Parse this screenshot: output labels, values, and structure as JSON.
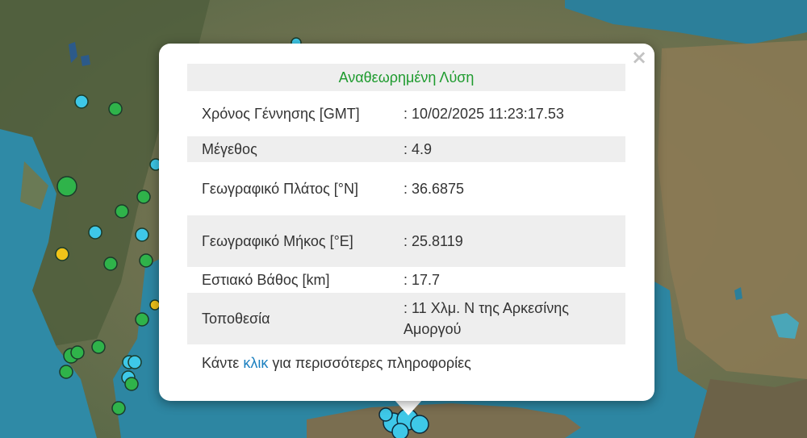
{
  "popup": {
    "title": "Αναθεωρημένη Λύση",
    "close_symbol": "×",
    "rows": [
      {
        "label": "Χρόνος Γέννησης [GMT]",
        "value": ": 10/02/2025 11:23:17.53"
      },
      {
        "label": "Μέγεθος",
        "value": ": 4.9"
      },
      {
        "label": "Γεωγραφικό Πλάτος [°N]",
        "value": ": 36.6875"
      },
      {
        "label": "Γεωγραφικό Μήκος [°E]",
        "value": ": 25.8119"
      },
      {
        "label": "Εστιακό Βάθος [km]",
        "value": ": 17.7"
      },
      {
        "label": "Τοποθεσία",
        "value": ": 11 Χλμ. Ν της Αρκεσίνης Αμοργού"
      }
    ],
    "footer_prefix": "Κάντε ",
    "footer_link": "κλικ",
    "footer_suffix": " για περισσότερες πληροφορίες"
  },
  "map": {
    "marker_colors": {
      "green": "#2fb34a",
      "cyan": "#3ec8e8",
      "yellow": "#f0c419"
    }
  }
}
